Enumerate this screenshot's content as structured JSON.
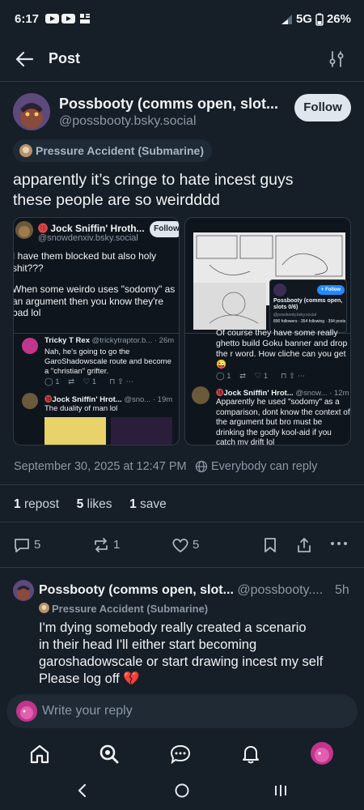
{
  "status_bar": {
    "time": "6:17",
    "network": "5G",
    "battery": "26%"
  },
  "header": {
    "title": "Post"
  },
  "post": {
    "author_name": "Possbooty (comms open, slot...",
    "handle": "@possbooty.bsky.social",
    "follow_label": "Follow",
    "label_badge": "Pressure Accident (Submarine)",
    "text_line1": "apparently it’s cringe to hate incest guys",
    "text_line2": "these people are so weirdddd",
    "timestamp": "September 30, 2025 at 12:47 PM",
    "reply_setting": "Everybody can reply",
    "stats": {
      "reposts": "1",
      "reposts_label": "repost",
      "likes": "5",
      "likes_label": "likes",
      "saves": "1",
      "saves_label": "save"
    },
    "actions": {
      "replies": "5",
      "reposts": "1",
      "likes": "5"
    }
  },
  "embed_left": {
    "author": "Jock Sniffin' Hroth...",
    "handle": "@snowdenxiv.bsky.social",
    "follow_label": "Follow",
    "text1": "I have them blocked but also holy",
    "text2": "shit???",
    "text3": "When some weirdo uses \"sodomy\" as",
    "text4": "an argument then you know they're",
    "text5": "bad lol",
    "reply1_author": "Tricky T Rex",
    "reply1_handle": "@trickytraptor.b...",
    "reply1_time": "· 26m",
    "reply1_text1": "Nah, he's going to go the",
    "reply1_text2": "GaroShadowscale route and become",
    "reply1_text3": "a \"christian\" grifter.",
    "reply1_reposts": "1",
    "reply1_likes": "1",
    "reply2_author": "Jock Sniffin' Hrot...",
    "reply2_handle": "@sno...",
    "reply2_time": "· 19m",
    "reply2_text": "The duality of man lol"
  },
  "embed_right": {
    "card_title": "Possbooty (comms open, slots 0/6)",
    "card_handle": "@possbooty.bsky.social",
    "card_follow": "+ Follow",
    "card_sub": "890 followers · 354 following · 394 posts",
    "text1": "Of course they have some really",
    "text2": "ghetto build Goku banner and drop",
    "text3": "the r word. How cliche can you get",
    "text4": "😜",
    "reposts": "1",
    "likes": "1",
    "reply_author": "Jock Sniffin' Hrot...",
    "reply_handle": "@snow...",
    "reply_time": "· 12m",
    "reply_text1": "Apparently he used \"sodomy\" as a",
    "reply_text2": "comparison, dont know the context of",
    "reply_text3": "the argument but bro must be",
    "reply_text4": "drinking the godly kool-aid if you",
    "reply_text5": "catch my drift lol"
  },
  "reply": {
    "author_name": "Possbooty (comms open, slot...",
    "handle": "@possbooty....",
    "time": "5h",
    "label_badge": "Pressure Accident (Submarine)",
    "text1": "I'm dying somebody really created a scenario",
    "text2": "in their head I'll either start becoming",
    "text3": "garoshadowscale or start drawing incest my self",
    "text4": "Please log off 💔"
  },
  "composer": {
    "placeholder": "Write your reply"
  },
  "colors": {
    "background": "#161e27",
    "accent": "#208bfe",
    "muted": "#8b98a5",
    "follow_bg": "#dfe6ed"
  }
}
